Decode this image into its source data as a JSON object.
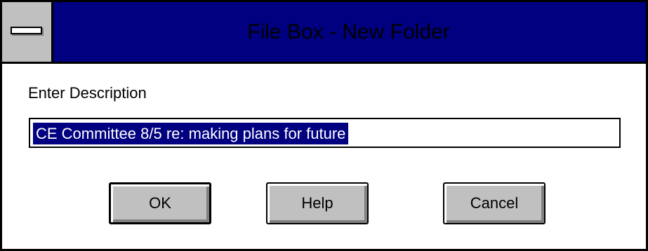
{
  "dialog": {
    "title": "File Box - New Folder",
    "prompt": "Enter Description",
    "input_value": "CE Committee 8/5 re: making plans for future"
  },
  "buttons": {
    "ok": "OK",
    "help": "Help",
    "cancel": "Cancel"
  },
  "colors": {
    "titlebar": "#000080",
    "button_face": "#c0c0c0",
    "selection": "#000080"
  },
  "icons": {
    "system_menu": "system-menu-icon"
  }
}
